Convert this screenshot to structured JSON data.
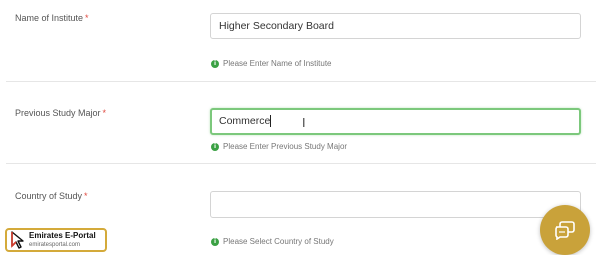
{
  "form": {
    "fields": [
      {
        "label": "Name of Institute",
        "required_mark": "*",
        "value": "Higher Secondary Board",
        "hint": "Please Enter Name of Institute"
      },
      {
        "label": "Previous Study Major",
        "required_mark": "*",
        "value": "Commerce",
        "hint": "Please Enter Previous Study Major"
      },
      {
        "label": "Country of Study",
        "required_mark": "*",
        "value": "",
        "select_arrows": "× ▾",
        "hint": "Please Select Country of Study"
      }
    ]
  },
  "brand": {
    "name": "Emirates E-Portal",
    "url": "emiratesportal.com"
  },
  "icons": {
    "hint": "info-icon",
    "chat": "chat-icon",
    "brand": "cursor-logo-icon"
  },
  "colors": {
    "required": "#e0483e",
    "info": "#3ba144",
    "active_border": "#7cc87c",
    "chat_button": "#c9a23a",
    "brand_border": "#d4aa3a"
  }
}
